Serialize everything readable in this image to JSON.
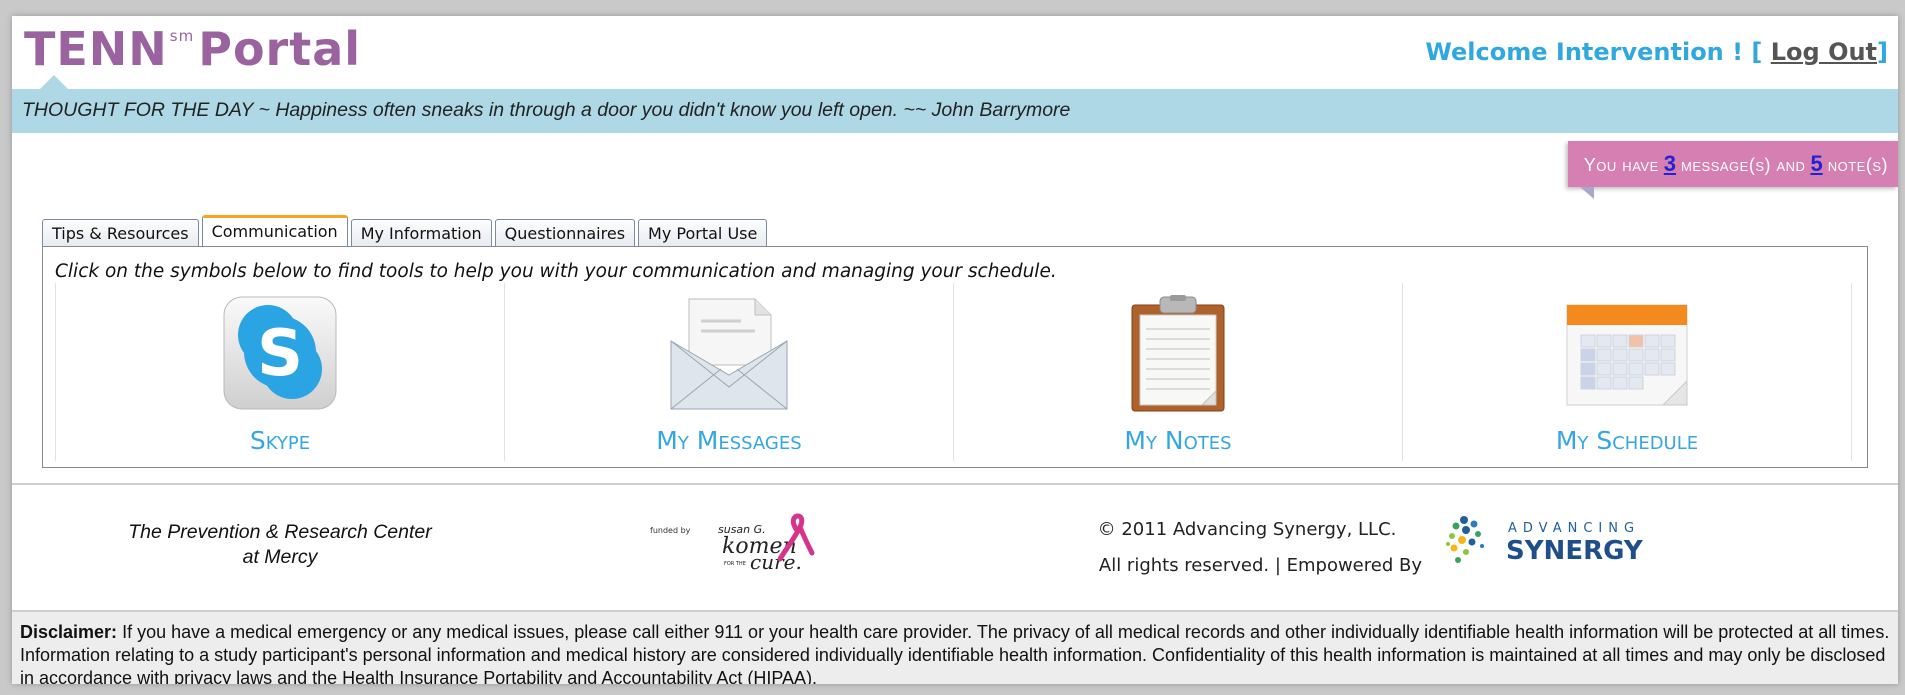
{
  "header": {
    "logo_main": "TENN",
    "logo_sup": "sm",
    "logo_portal": "Portal",
    "welcome_text": "Welcome Intervention ! [",
    "logout_label": "Log Out",
    "welcome_close": "]"
  },
  "thought": "THOUGHT FOR THE DAY ~ Happiness often sneaks in through a door you didn't know you left open. ~~ John Barrymore",
  "notifications": {
    "prefix": "You have",
    "message_count": "3",
    "middle": "message(s) and",
    "note_count": "5",
    "suffix": "note(s)"
  },
  "tabs": [
    {
      "label": "Tips & Resources",
      "active": false
    },
    {
      "label": "Communication",
      "active": true
    },
    {
      "label": "My Information",
      "active": false
    },
    {
      "label": "Questionnaires",
      "active": false
    },
    {
      "label": "My Portal Use",
      "active": false
    }
  ],
  "panel": {
    "intro": "Click on the symbols below to find tools to help you with your communication and managing your schedule.",
    "tools": [
      {
        "label": "Skype",
        "icon": "skype-icon"
      },
      {
        "label": "My Messages",
        "icon": "envelope-icon"
      },
      {
        "label": "My Notes",
        "icon": "clipboard-icon"
      },
      {
        "label": "My Schedule",
        "icon": "calendar-icon"
      }
    ]
  },
  "footer": {
    "org_line1": "The Prevention & Research Center",
    "org_line2": "at Mercy",
    "komen_funded": "funded by",
    "komen_name1": "susan G.",
    "komen_name2": "komen",
    "komen_for_the": "FOR THE",
    "komen_cure": "cure.",
    "copyright": "© 2011 Advancing Synergy, LLC.",
    "rights": "All rights reserved.  |  Empowered By",
    "synergy_top": "ADVANCING",
    "synergy_bottom": "SYNERGY"
  },
  "disclaimer": {
    "label": "Disclaimer:",
    "text": " If you have a medical emergency or any medical issues, please call either 911 or your health care provider. The privacy of all medical records and other individually identifiable health information will be protected at all times. Information relating to a study participant's personal information and medical history are considered individually identifiable health information. Confidentiality of this health information is maintained at all times and may only be disclosed in accordance with privacy laws and the Health Insurance Portability and Accountability Act (HIPAA)."
  },
  "colors": {
    "brand_purple": "#9a63a0",
    "accent_blue": "#2fa8e0",
    "thought_bar": "#aed8e6",
    "badge_pink": "#d67fb2",
    "tab_active_border": "#f6a623"
  }
}
